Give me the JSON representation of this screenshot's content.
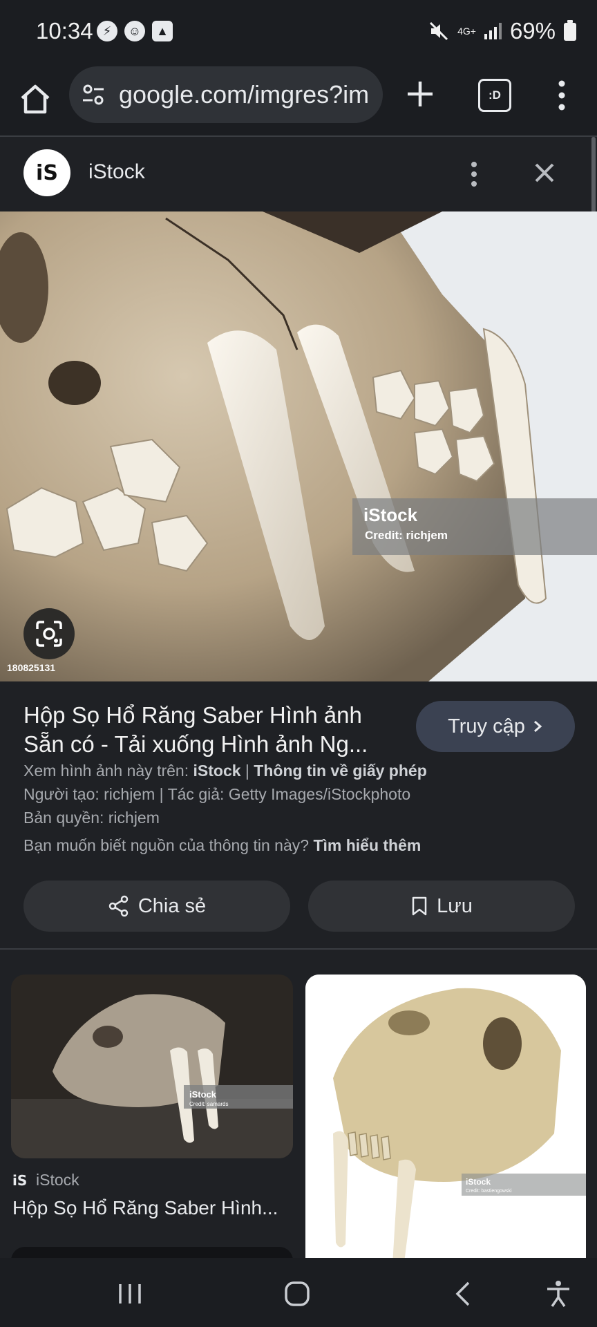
{
  "status_bar": {
    "time": "10:34",
    "network": "4G+",
    "battery": "69%"
  },
  "browser": {
    "url": "google.com/imgres?im",
    "tabs_count": ":D"
  },
  "source": {
    "name": "iStock",
    "logo_text": "iS"
  },
  "main_image": {
    "watermark": "iStock",
    "credit": "Credit: richjem",
    "image_id": "180825131"
  },
  "result": {
    "title": "Hộp Sọ Hổ Răng Saber Hình ảnh Sẵn có - Tải xuống Hình ảnh Ng...",
    "visit_label": "Truy cập",
    "view_prefix": "Xem hình ảnh này trên:",
    "view_site": "iStock",
    "separator": "|",
    "license_link": "Thông tin về giấy phép",
    "creator_line": "Người tạo: richjem | Tác giả: Getty Images/iStockphoto",
    "copyright_line": "Bản quyền: richjem",
    "source_question": "Bạn muốn biết nguồn của thông tin này?",
    "learn_more": "Tìm hiểu thêm",
    "share_label": "Chia sẻ",
    "save_label": "Lưu"
  },
  "related": [
    {
      "source": "iStock",
      "logo_text": "iS",
      "title": "Hộp Sọ Hổ Răng Saber Hình...",
      "watermark": "iStock",
      "credit": "Credit: samards"
    },
    {
      "watermark": "iStock",
      "credit": "Credit: bastiengowski"
    }
  ]
}
